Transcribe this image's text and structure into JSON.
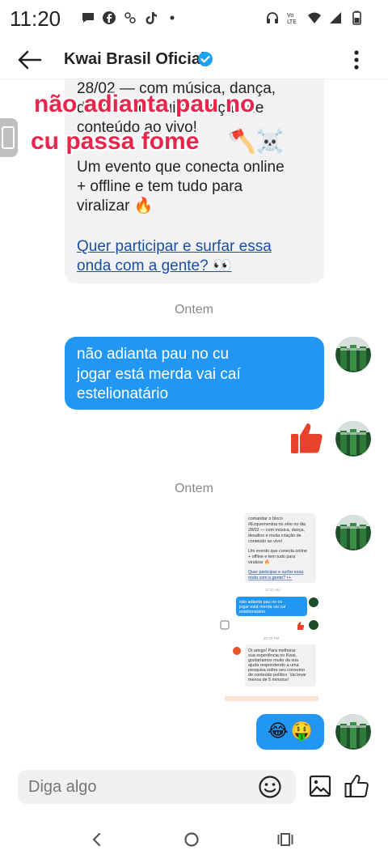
{
  "status_bar": {
    "time": "11:20",
    "left_icons": [
      "chat-bubble-icon",
      "facebook-icon",
      "app-icon",
      "tiktok-icon",
      "dot-icon"
    ],
    "right_icons": [
      "headphones-icon",
      "volte-icon",
      "wifi-icon",
      "signal-icon",
      "battery-icon"
    ]
  },
  "header": {
    "title": "Kwai Brasil Oficial",
    "verified": true,
    "accent_color": "#1da1f2"
  },
  "overlay": {
    "line1": "não adianta pau no",
    "line2": "cu passa fome",
    "emojis": "🪓☠️",
    "color": "#e8254a"
  },
  "incoming_message": {
    "lines": [
      "28/02 — com música, dança,",
      "desafios e muita criação de",
      "conteúdo ao vivo!"
    ],
    "body_lines": [
      "Um evento que conecta online",
      "+ offline e tem tudo para",
      "viralizar 🔥"
    ],
    "link_lines": [
      "Quer participar e surfar essa",
      "onda com a gente? 👀"
    ]
  },
  "separators": [
    "Ontem",
    "Ontem"
  ],
  "outgoing_message": {
    "lines": [
      "não adianta pau no cu",
      "jogar está merda vai caí",
      "estelionatário"
    ],
    "bubble_color": "#2196f3"
  },
  "screenshot_message": {
    "texts": {
      "top": [
        "comandar o bloco",
        "#Ecquemenina no sítio no dia",
        "28/02 — com música, dança,",
        "desafios e muita criação de",
        "conteúdo ao vivo!"
      ],
      "mid": [
        "Um evento que conecta online",
        "+ offline e tem tudo para",
        "viralizar 🔥"
      ],
      "link": [
        "Quer participar e surfar essa",
        "onda com a gente? 👀"
      ],
      "time1": "17:21 Alo",
      "out": [
        "não adianta pau no cu",
        "jogar está merda vai caí",
        "estelionatário"
      ],
      "time2": "20:33 PM",
      "reply": [
        "Oi amigo! Para melhorar",
        "sua experiência no Kwai,",
        "gostaríamos muito da sua",
        "ajuda respondendo a uma",
        "pesquisa sobre seu consumo",
        "de conteúdo político. Vai levar",
        "menos de 5 minutos!"
      ]
    }
  },
  "emoji_message": {
    "text": "😂🤑"
  },
  "composer": {
    "placeholder": "Diga algo"
  }
}
